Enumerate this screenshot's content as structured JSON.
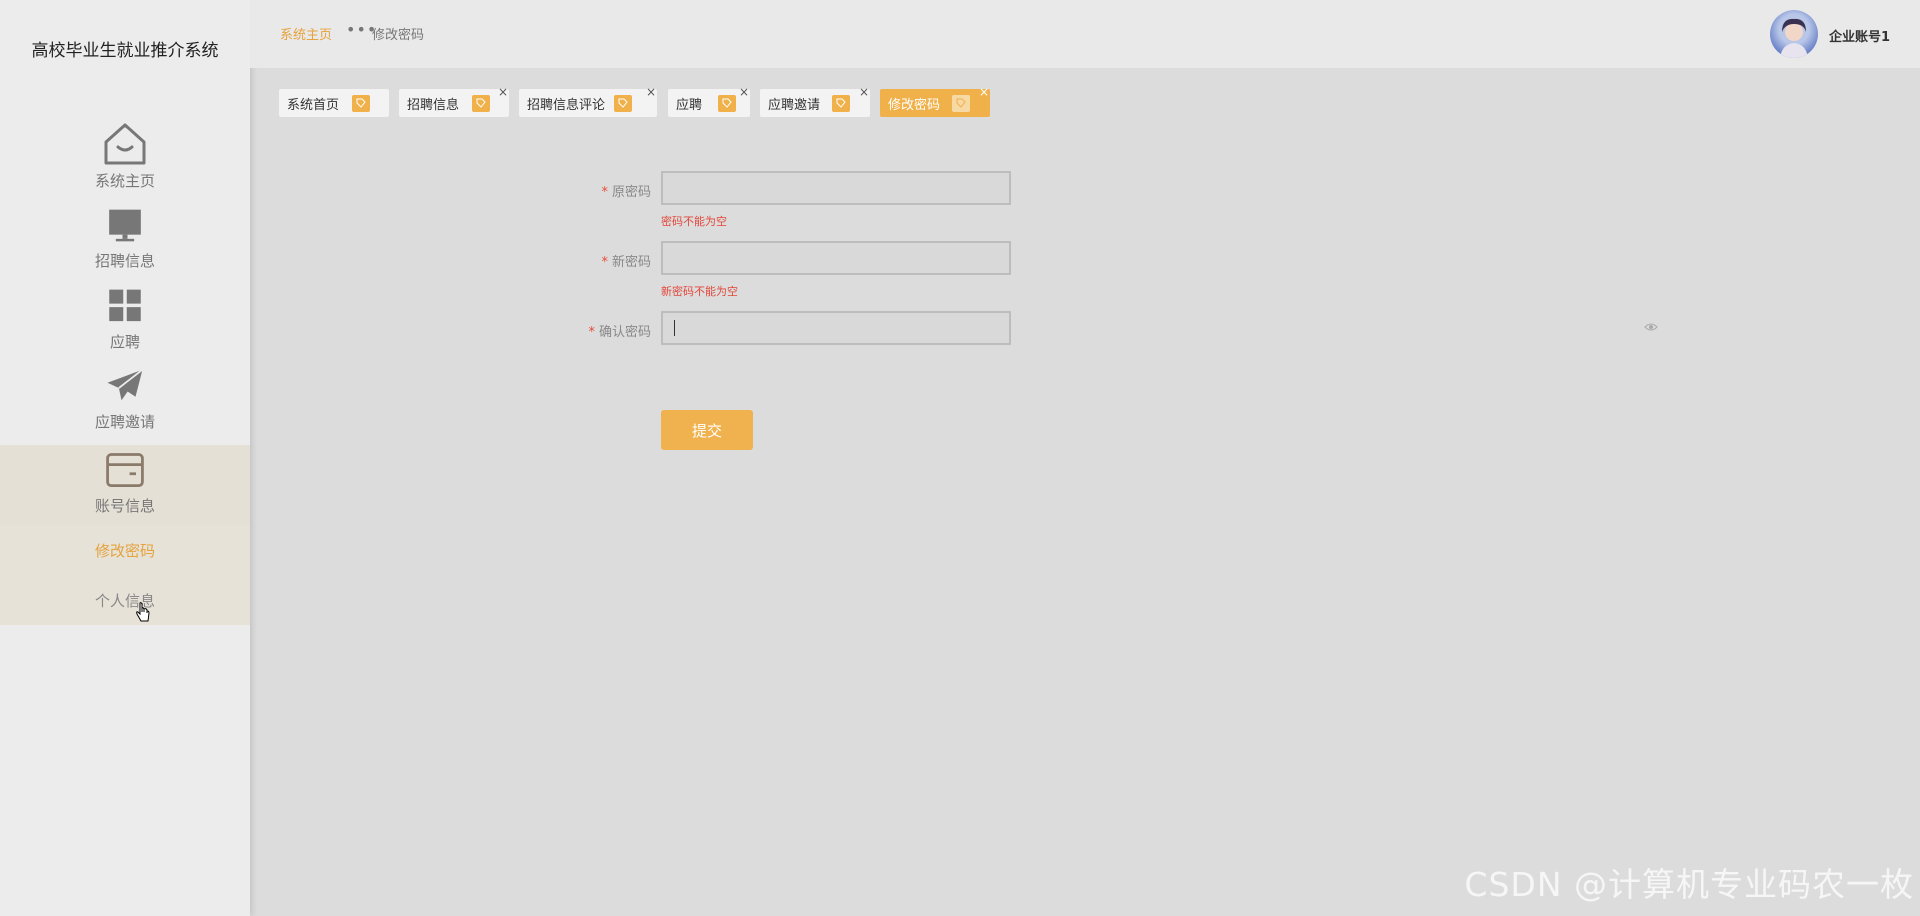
{
  "app": {
    "title": "高校毕业生就业推介系统"
  },
  "sidebar": {
    "items": [
      {
        "label": "系统主页",
        "icon": "home-icon"
      },
      {
        "label": "招聘信息",
        "icon": "monitor-icon"
      },
      {
        "label": "应聘",
        "icon": "grid-icon"
      },
      {
        "label": "应聘邀请",
        "icon": "paper-plane-icon"
      },
      {
        "label": "账号信息",
        "icon": "card-icon"
      }
    ],
    "subitems": [
      {
        "label": "修改密码"
      },
      {
        "label": "个人信息"
      }
    ]
  },
  "header": {
    "breadcrumb_home": "系统主页",
    "breadcrumb_sep": "•••",
    "breadcrumb_current": "修改密码",
    "account_name": "企业账号1"
  },
  "tabs": [
    {
      "label": "系统首页",
      "closable": false
    },
    {
      "label": "招聘信息",
      "closable": true
    },
    {
      "label": "招聘信息评论",
      "closable": true
    },
    {
      "label": "应聘",
      "closable": true
    },
    {
      "label": "应聘邀请",
      "closable": true
    },
    {
      "label": "修改密码",
      "closable": true,
      "active": true
    }
  ],
  "form": {
    "old_password": {
      "label": "原密码",
      "value": "",
      "error": "密码不能为空"
    },
    "new_password": {
      "label": "新密码",
      "value": "",
      "error": "新密码不能为空"
    },
    "confirm_password": {
      "label": "确认密码",
      "value": ""
    },
    "required_mark": "*",
    "submit_label": "提交"
  },
  "close_glyph": "×",
  "watermark": "CSDN @计算机专业码农一枚",
  "colors": {
    "accent": "#f0b14a",
    "error": "#e2473b",
    "sidebar_bg": "#ececec",
    "main_bg": "#dcdcdc"
  }
}
